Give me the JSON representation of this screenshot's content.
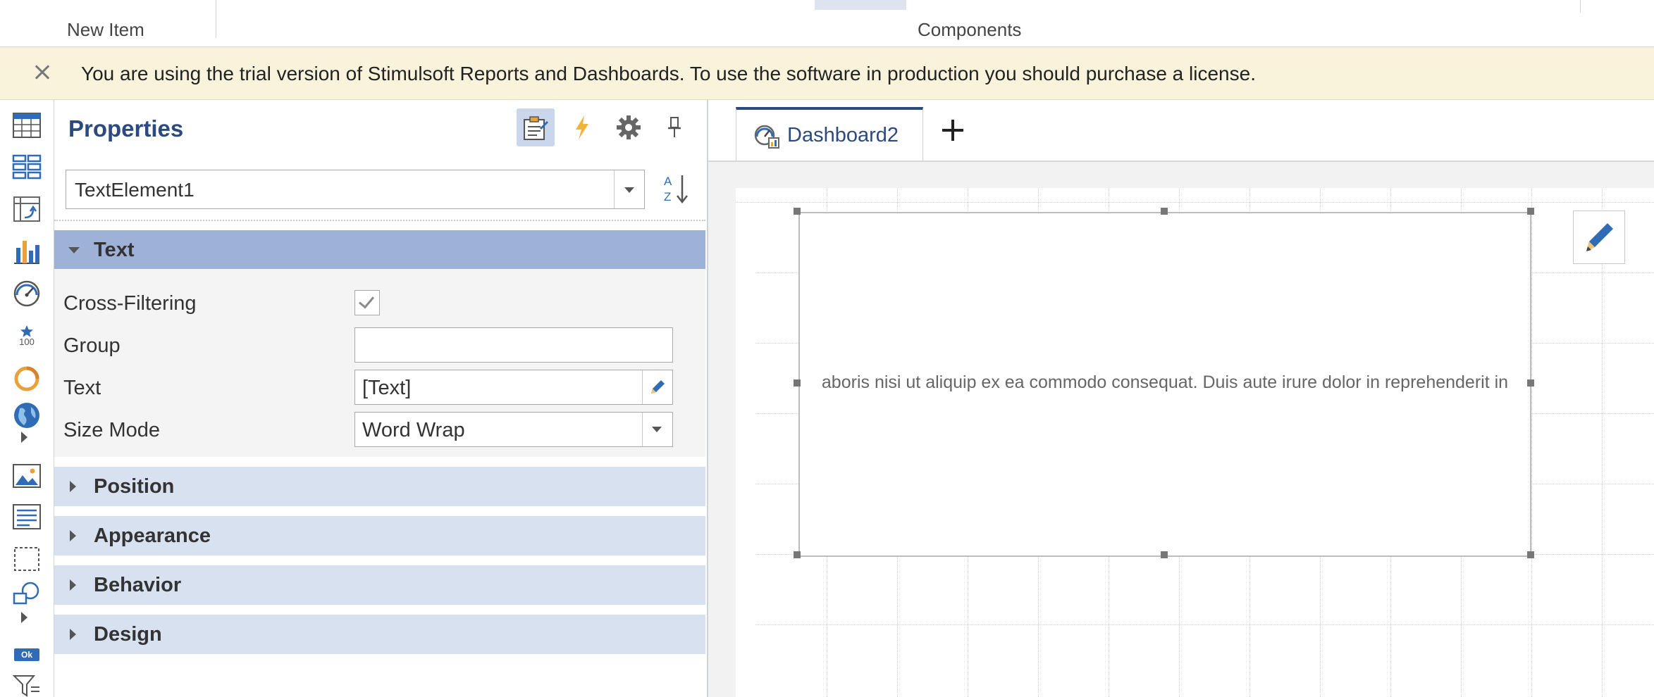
{
  "ribbon": {
    "groups": [
      {
        "label": "New Item"
      },
      {
        "label": "Components"
      }
    ]
  },
  "banner": {
    "message": "You are using the trial version of Stimulsoft Reports and Dashboards. To use the software in production you should purchase a license."
  },
  "toolbox": {
    "items": [
      "table-icon",
      "cards-icon",
      "pivot-table-icon",
      "chart-icon",
      "gauge-icon",
      "indicator-icon",
      "progress-icon",
      "region-map-icon",
      "image-icon",
      "text-icon",
      "panel-icon",
      "shape-icon",
      "button-icon",
      "filter-icon"
    ],
    "indicator_caption": "100",
    "button_caption": "Ok"
  },
  "properties": {
    "title": "Properties",
    "selected_component": "TextElement1",
    "categories": [
      {
        "name": "Text",
        "expanded": true
      },
      {
        "name": "Position",
        "expanded": false
      },
      {
        "name": "Appearance",
        "expanded": false
      },
      {
        "name": "Behavior",
        "expanded": false
      },
      {
        "name": "Design",
        "expanded": false
      }
    ],
    "text_props": {
      "cross_filtering_label": "Cross-Filtering",
      "cross_filtering_value": true,
      "group_label": "Group",
      "group_value": "",
      "text_label": "Text",
      "text_value": "[Text]",
      "size_mode_label": "Size Mode",
      "size_mode_value": "Word Wrap"
    },
    "toolbar_icons": [
      "properties-icon",
      "events-icon",
      "settings-icon",
      "pin-icon"
    ],
    "sort_icon": "sort-az-icon"
  },
  "designer": {
    "tabs": [
      {
        "label": "Dashboard2",
        "active": true
      }
    ],
    "element_text": "aboris nisi ut aliquip ex ea commodo consequat. Duis aute irure dolor in reprehenderit in"
  },
  "colors": {
    "accent": "#2b4a82",
    "banner_bg": "#faf3dc",
    "category_open": "#9eb1d6",
    "category_closed": "#d7e1ef"
  }
}
